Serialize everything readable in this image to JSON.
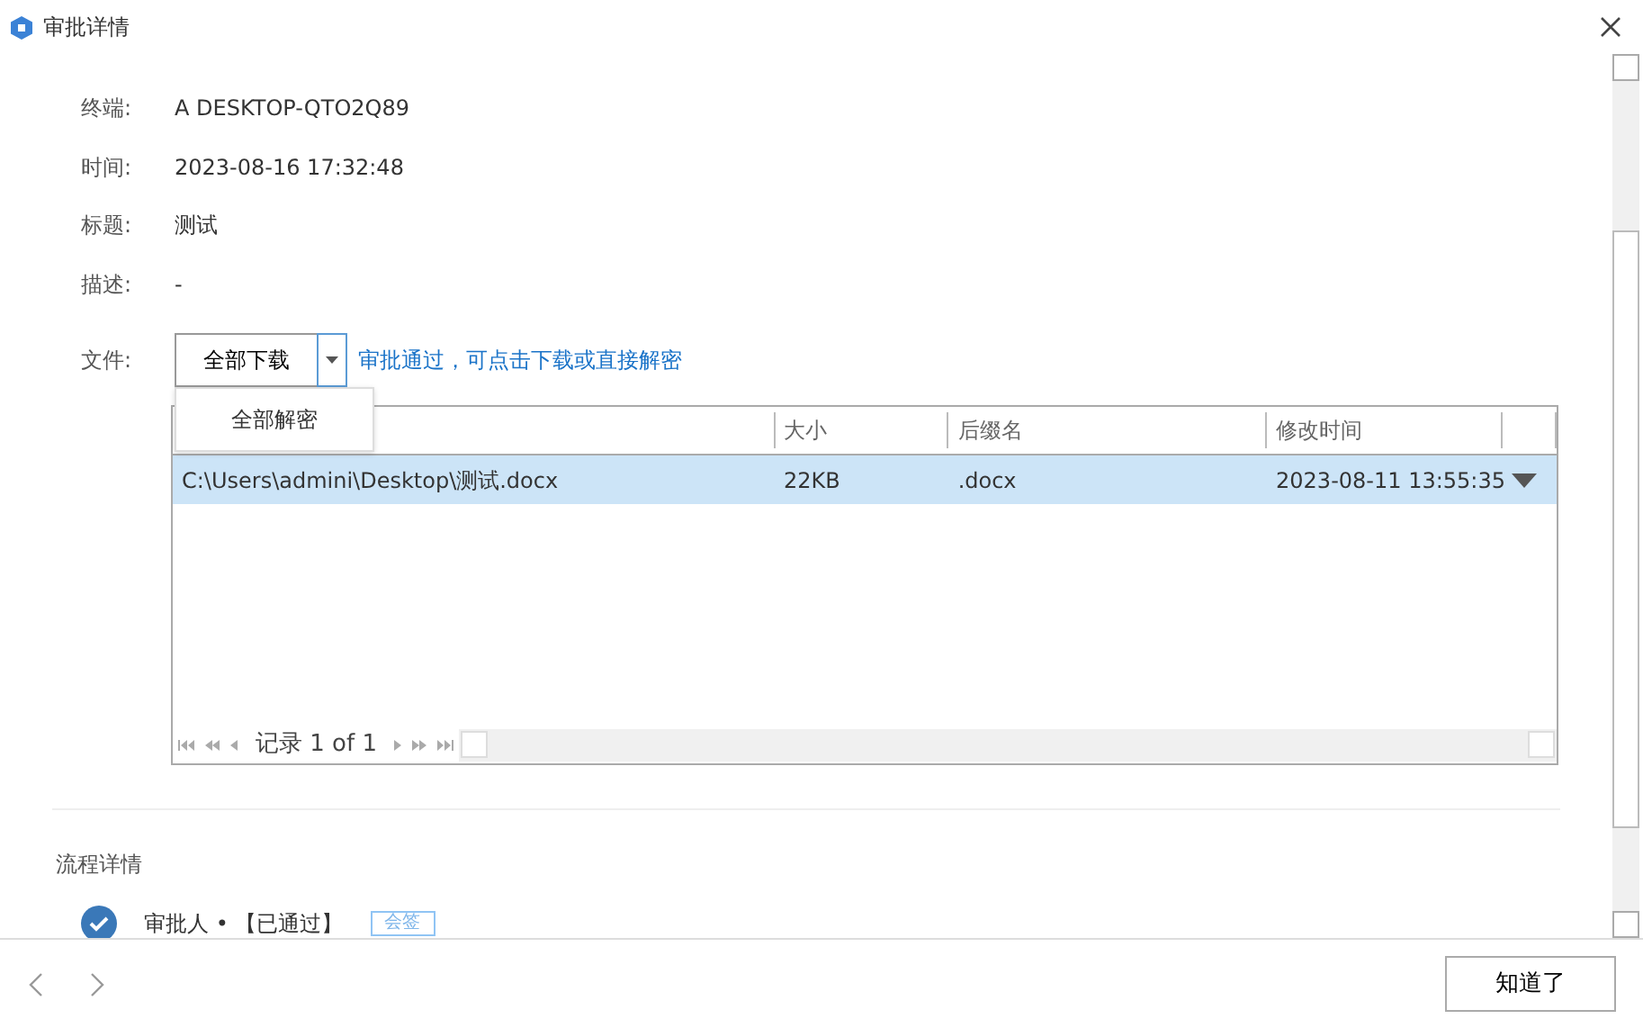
{
  "window": {
    "title": "审批详情"
  },
  "fields": [
    {
      "label": "终端:",
      "value": "A DESKTOP-QTO2Q89"
    },
    {
      "label": "时间:",
      "value": "2023-08-16 17:32:48"
    },
    {
      "label": "标题:",
      "value": "测试"
    },
    {
      "label": "描述:",
      "value": "-"
    }
  ],
  "file": {
    "label": "文件:",
    "split_button": "全部下载",
    "menu": [
      {
        "label": "全部解密"
      }
    ],
    "hint": "审批通过，可点击下载或直接解密"
  },
  "table": {
    "columns": [
      "",
      "大小",
      "后缀名",
      "修改时间"
    ],
    "rows": [
      {
        "cells": [
          "C:\\Users\\admini\\Desktop\\测试.docx",
          "22KB",
          ".docx",
          "2023-08-11 13:55:35"
        ],
        "selected": true
      }
    ],
    "pager": "记录 1 of 1"
  },
  "process": {
    "title": "流程详情",
    "steps": [
      {
        "text": "审批人 • 【已通过】",
        "tag": "会签",
        "done": true
      }
    ]
  },
  "footer": {
    "button": "知道了"
  }
}
